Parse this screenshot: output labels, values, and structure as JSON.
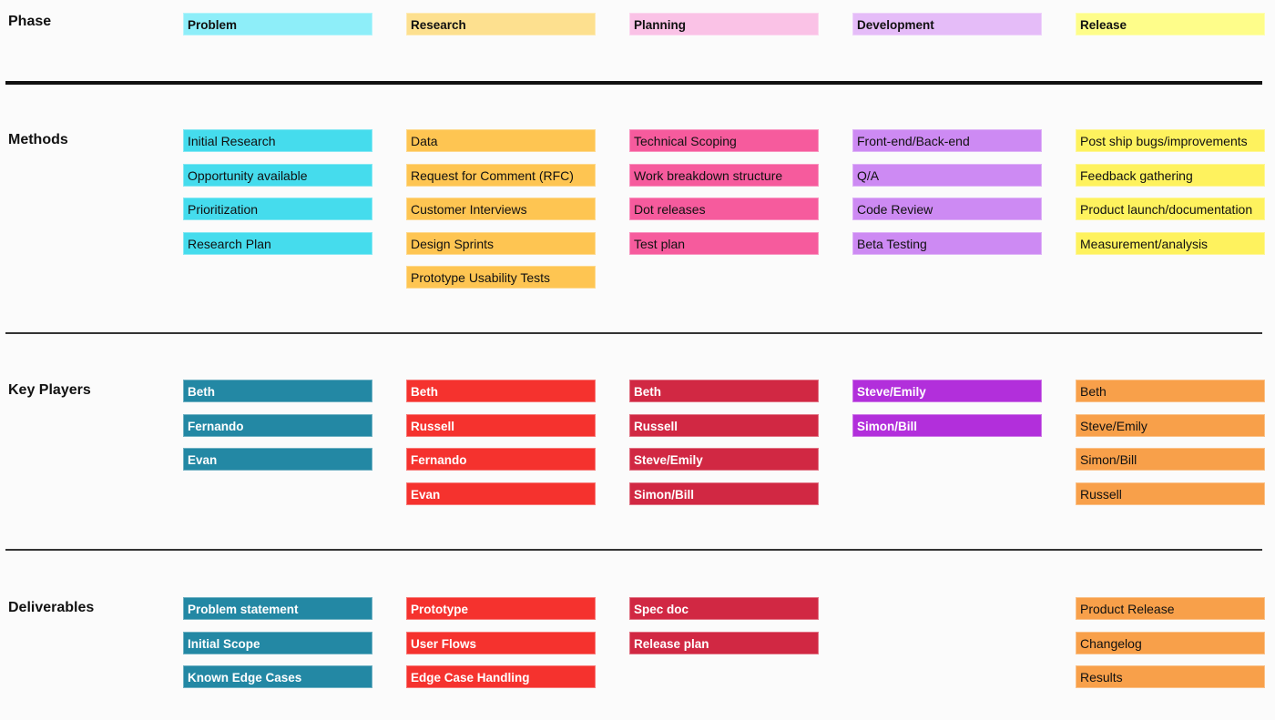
{
  "rows": {
    "phase": "Phase",
    "methods": "Methods",
    "key_players": "Key Players",
    "deliverables": "Deliverables"
  },
  "phases": [
    {
      "name": "Problem",
      "phase_color": "#8eeef9",
      "methods_color": "#45dced",
      "dark_color": "#2388a4",
      "methods": [
        "Initial Research",
        "Opportunity available",
        "Prioritization",
        "Research Plan"
      ],
      "key_players": [
        "Beth",
        "Fernando",
        "Evan"
      ],
      "deliverables": [
        "Problem statement",
        "Initial Scope",
        "Known Edge Cases"
      ]
    },
    {
      "name": "Research",
      "phase_color": "#fde08f",
      "methods_color": "#fec552",
      "dark_color": "#f5322e",
      "methods": [
        "Data",
        "Request for Comment (RFC)",
        "Customer Interviews",
        "Design Sprints",
        "Prototype Usability Tests"
      ],
      "key_players": [
        "Beth",
        "Russell",
        "Fernando",
        "Evan"
      ],
      "deliverables": [
        "Prototype",
        "User Flows",
        "Edge Case Handling"
      ]
    },
    {
      "name": "Planning",
      "phase_color": "#fac2e6",
      "methods_color": "#f65b9d",
      "dark_color": "#d12843",
      "methods": [
        "Technical Scoping",
        "Work breakdown structure",
        "Dot releases",
        "Test plan"
      ],
      "key_players": [
        "Beth",
        "Russell",
        "Steve/Emily",
        "Simon/Bill"
      ],
      "deliverables": [
        "Spec doc",
        "Release plan"
      ]
    },
    {
      "name": "Development",
      "phase_color": "#e5bcf8",
      "methods_color": "#cd8af3",
      "dark_color": "#b22fdb",
      "methods": [
        "Front-end/Back-end",
        "Q/A",
        "Code Review",
        "Beta Testing"
      ],
      "key_players": [
        "Steve/Emily",
        "Simon/Bill"
      ],
      "deliverables": []
    },
    {
      "name": "Release",
      "phase_color": "#fefd8a",
      "methods_color": "#fef25e",
      "dark_color": "#f8a04a",
      "methods": [
        "Post ship bugs/improvements",
        "Feedback gathering",
        "Product launch/documentation",
        "Measurement/analysis"
      ],
      "key_players": [
        "Beth",
        "Steve/Emily",
        "Simon/Bill",
        "Russell"
      ],
      "deliverables": [
        "Product Release",
        "Changelog",
        "Results"
      ]
    }
  ]
}
